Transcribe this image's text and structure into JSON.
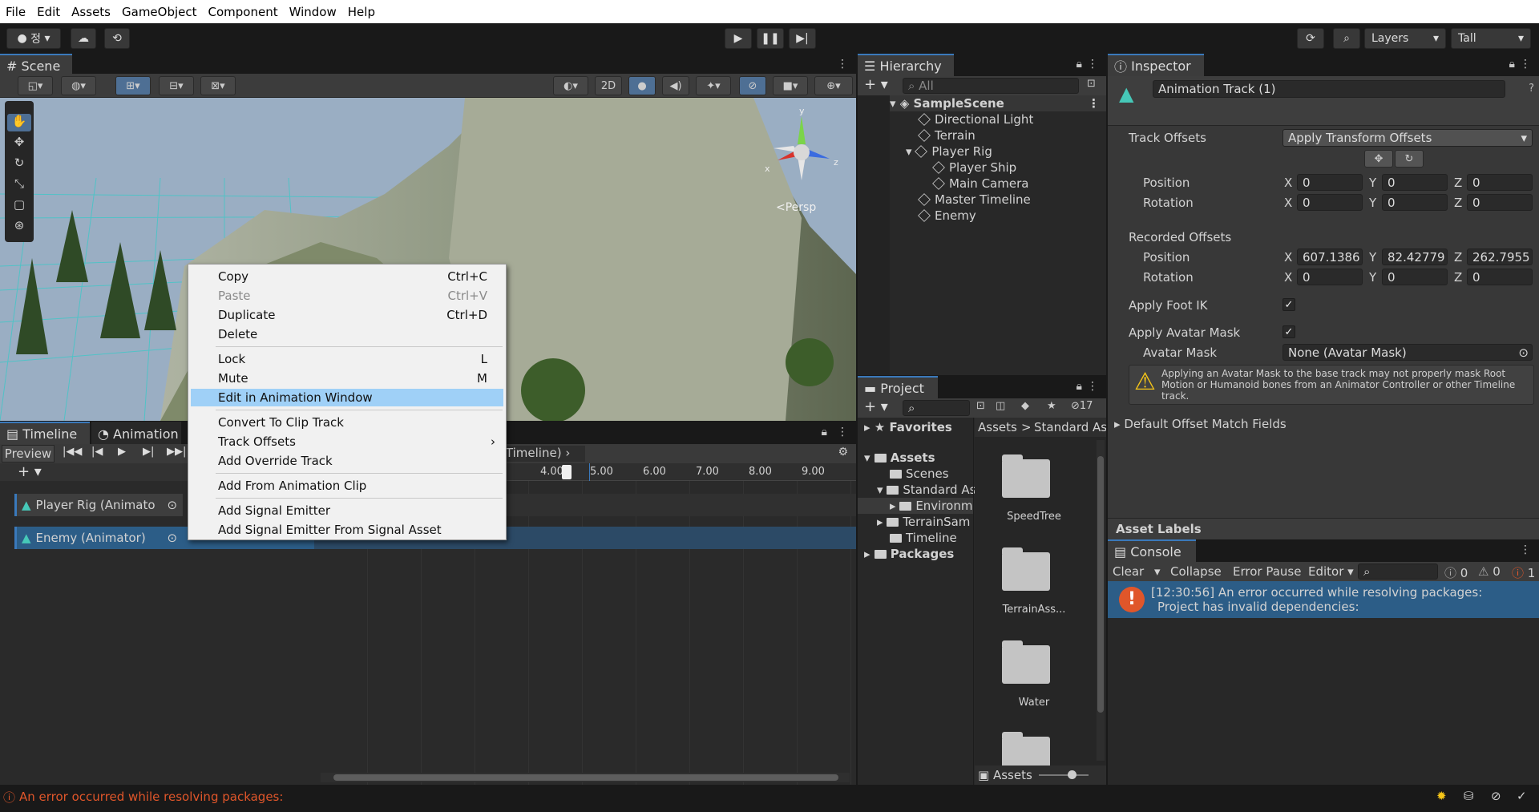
{
  "menubar": [
    "File",
    "Edit",
    "Assets",
    "GameObject",
    "Component",
    "Window",
    "Help"
  ],
  "toolbar": {
    "account_label": "정",
    "layers_label": "Layers",
    "layout_label": "Tall"
  },
  "scene": {
    "tab_label": "Scene",
    "mode_2d": "2D",
    "gizmo_persp": "Persp",
    "gizmo_axes": {
      "x": "x",
      "y": "y",
      "z": "z"
    }
  },
  "context_menu": {
    "items": [
      {
        "label": "Copy",
        "shortcut": "Ctrl+C",
        "disabled": false
      },
      {
        "label": "Paste",
        "shortcut": "Ctrl+V",
        "disabled": true
      },
      {
        "label": "Duplicate",
        "shortcut": "Ctrl+D",
        "disabled": false
      },
      {
        "label": "Delete",
        "shortcut": "",
        "disabled": false
      },
      {
        "label": "Lock",
        "shortcut": "L",
        "disabled": false
      },
      {
        "label": "Mute",
        "shortcut": "M",
        "disabled": false
      },
      {
        "label": "Edit in Animation Window",
        "shortcut": "",
        "disabled": false,
        "selected": true
      },
      {
        "label": "Convert To Clip Track",
        "shortcut": "",
        "disabled": false
      },
      {
        "label": "Track Offsets",
        "shortcut": "",
        "submenu": true
      },
      {
        "label": "Add Override Track",
        "shortcut": ""
      },
      {
        "label": "Add From Animation Clip",
        "shortcut": ""
      },
      {
        "label": "Add Signal Emitter",
        "shortcut": ""
      },
      {
        "label": "Add Signal Emitter From Signal Asset",
        "shortcut": ""
      }
    ],
    "submenu_arrow": "›"
  },
  "timeline": {
    "tab_timeline": "Timeline",
    "tab_animation": "Animation",
    "preview_label": "Preview",
    "breadcrumb_tail": "r Timeline)",
    "ruler": [
      "4.00",
      "5.00",
      "6.00",
      "7.00",
      "8.00",
      "9.00"
    ],
    "tracks": [
      {
        "label": "Player Rig (Animato"
      },
      {
        "label": "Enemy (Animator)"
      }
    ]
  },
  "hierarchy": {
    "tab_label": "Hierarchy",
    "search_placeholder": "All",
    "scene_name": "SampleScene",
    "items": [
      {
        "label": "Directional Light",
        "depth": 1
      },
      {
        "label": "Terrain",
        "depth": 1
      },
      {
        "label": "Player Rig",
        "depth": 1,
        "expanded": true
      },
      {
        "label": "Player Ship",
        "depth": 2
      },
      {
        "label": "Main Camera",
        "depth": 2
      },
      {
        "label": "Master Timeline",
        "depth": 1
      },
      {
        "label": "Enemy",
        "depth": 1
      }
    ]
  },
  "project": {
    "tab_label": "Project",
    "hidden_count": "17",
    "breadcrumb": [
      "Assets",
      "Standard Ass"
    ],
    "tree": [
      {
        "label": "Favorites",
        "kind": "star",
        "bold": true
      },
      {
        "label": "Assets",
        "kind": "folder",
        "bold": true
      },
      {
        "label": "Scenes",
        "kind": "folder"
      },
      {
        "label": "Standard As",
        "kind": "folder"
      },
      {
        "label": "Environm",
        "kind": "folder"
      },
      {
        "label": "TerrainSam",
        "kind": "folder"
      },
      {
        "label": "Timeline",
        "kind": "folder"
      },
      {
        "label": "Packages",
        "kind": "folder",
        "bold": true
      }
    ],
    "grid": [
      {
        "label": "SpeedTree"
      },
      {
        "label": "TerrainAss..."
      },
      {
        "label": "Water"
      }
    ],
    "footer_label": "Assets"
  },
  "inspector": {
    "tab_label": "Inspector",
    "object_name": "Animation Track (1)",
    "track_offsets_label": "Track Offsets",
    "track_offsets_value": "Apply Transform Offsets",
    "position_label": "Position",
    "rotation_label": "Rotation",
    "axis_x": "X",
    "axis_y": "Y",
    "axis_z": "Z",
    "offset_position": [
      "0",
      "0",
      "0"
    ],
    "offset_rotation": [
      "0",
      "0",
      "0"
    ],
    "recorded_offsets_label": "Recorded Offsets",
    "recorded_position": [
      "607.1386",
      "82.42779",
      "262.7955"
    ],
    "recorded_rotation": [
      "0",
      "0",
      "0"
    ],
    "apply_foot_ik_label": "Apply Foot IK",
    "apply_avatar_mask_label": "Apply Avatar Mask",
    "avatar_mask_label": "Avatar Mask",
    "avatar_mask_value": "None (Avatar Mask)",
    "warning_text": "Applying an Avatar Mask to the base track may not properly mask Root Motion or Humanoid bones from an Animator Controller or other Timeline track.",
    "default_offset_label": "Default Offset Match Fields",
    "asset_labels": "Asset Labels"
  },
  "console": {
    "tab_label": "Console",
    "clear": "Clear",
    "collapse": "Collapse",
    "error_pause": "Error Pause",
    "editor": "Editor",
    "count_info": "0",
    "count_warn": "0",
    "count_error": "1",
    "message_line1": "[12:30:56] An error occurred while resolving packages:",
    "message_line2": "Project has invalid dependencies:"
  },
  "status": {
    "error_text": "An error occurred while resolving packages:"
  },
  "colors": {
    "accent": "#3a79bb",
    "selection": "#2c5d87",
    "error": "#e0562a",
    "menu_highlight": "#9fd0f7"
  }
}
